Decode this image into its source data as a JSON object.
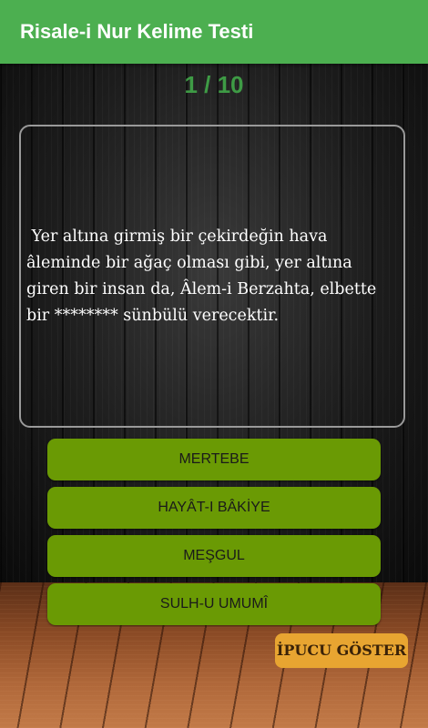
{
  "app_bar": {
    "title": "Risale-i Nur Kelime Testi",
    "color": "#4caf50"
  },
  "progress": {
    "text": "1 / 10",
    "current": 1,
    "total": 10
  },
  "question": {
    "text": " Yer altına girmiş bir çekirdeğin hava âleminde bir ağaç olması gibi, yer altına giren bir insan da, Âlem-i Berzahta, elbette bir ******** sünbülü verecektir."
  },
  "answers": [
    {
      "label": "MERTEBE"
    },
    {
      "label": "HAYÂT-I BÂKİYE"
    },
    {
      "label": "MEŞGUL"
    },
    {
      "label": "SULH-U UMUMÎ"
    }
  ],
  "hint_button": {
    "label": "İPUCU GÖSTER",
    "color": "#e8a531"
  },
  "colors": {
    "answer_button": "#6a9a04",
    "counter_text": "#3e9b45"
  }
}
